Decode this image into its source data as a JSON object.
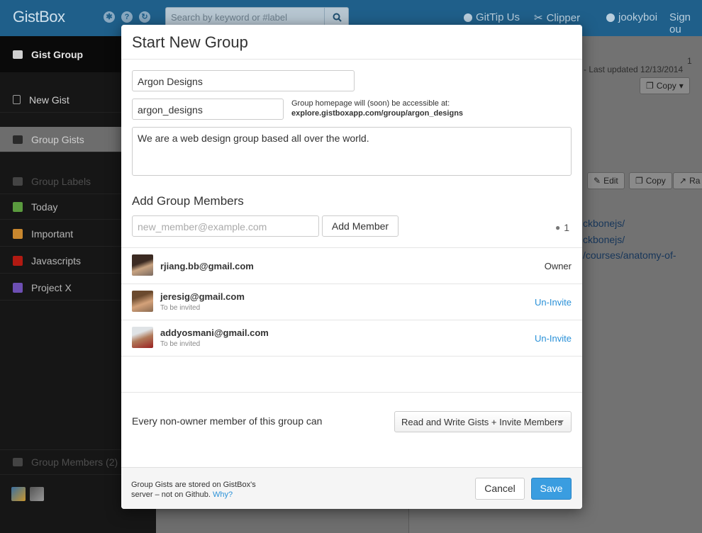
{
  "app": {
    "brand": "GistBox"
  },
  "header": {
    "search_placeholder": "Search by keyword or #label",
    "gittip": "GitTip Us",
    "clipper": "Clipper",
    "username": "jookyboi",
    "signout": "Sign ou"
  },
  "sidebar": {
    "group_name": "Gist Group",
    "new_gist": "New Gist",
    "group_gists": "Group Gists",
    "group_labels": "Group Labels",
    "labels": [
      {
        "name": "Today",
        "color": "#5a9a3e"
      },
      {
        "name": "Important",
        "color": "#c8872e"
      },
      {
        "name": "Javascripts",
        "color": "#b21a12"
      },
      {
        "name": "Project X",
        "color": "#6d4fb3"
      }
    ],
    "group_members": "Group Members (2)"
  },
  "background": {
    "file_count": "1",
    "last_updated": "- Last updated 12/13/2014",
    "copy_label": "Copy",
    "edit_label": "Edit",
    "copy2_label": "Copy",
    "raw_label": "Ra",
    "links": [
      "ckbonejs/",
      "ckbonejs/",
      "/courses/anatomy-of-"
    ]
  },
  "modal": {
    "title": "Start New Group",
    "group_name": "Argon Designs",
    "group_slug": "argon_designs",
    "hint_line1": "Group homepage will (soon) be accessible at:",
    "hint_line2": "explore.gistboxapp.com/group/argon_designs",
    "description": "We are a web design group based all over the world.",
    "members_title": "Add Group Members",
    "member_placeholder": "new_member@example.com",
    "add_member_label": "Add Member",
    "member_count": "1",
    "members": [
      {
        "email": "rjiang.bb@gmail.com",
        "status": "",
        "action": "Owner"
      },
      {
        "email": "jeresig@gmail.com",
        "status": "To be invited",
        "action": "Un-Invite"
      },
      {
        "email": "addyosmani@gmail.com",
        "status": "To be invited",
        "action": "Un-Invite"
      }
    ],
    "permission_label": "Every non-owner member of this group can",
    "permission_value": "Read and Write Gists + Invite Members",
    "footer_note_line1": "Group Gists are stored on GistBox's",
    "footer_note_line2": "server – not on Github.",
    "footer_link": "Why?",
    "cancel_label": "Cancel",
    "save_label": "Save"
  },
  "colors": {
    "accent": "#2a91d8",
    "topbar": "#1f5f8a",
    "save_button": "#3a9de0"
  }
}
